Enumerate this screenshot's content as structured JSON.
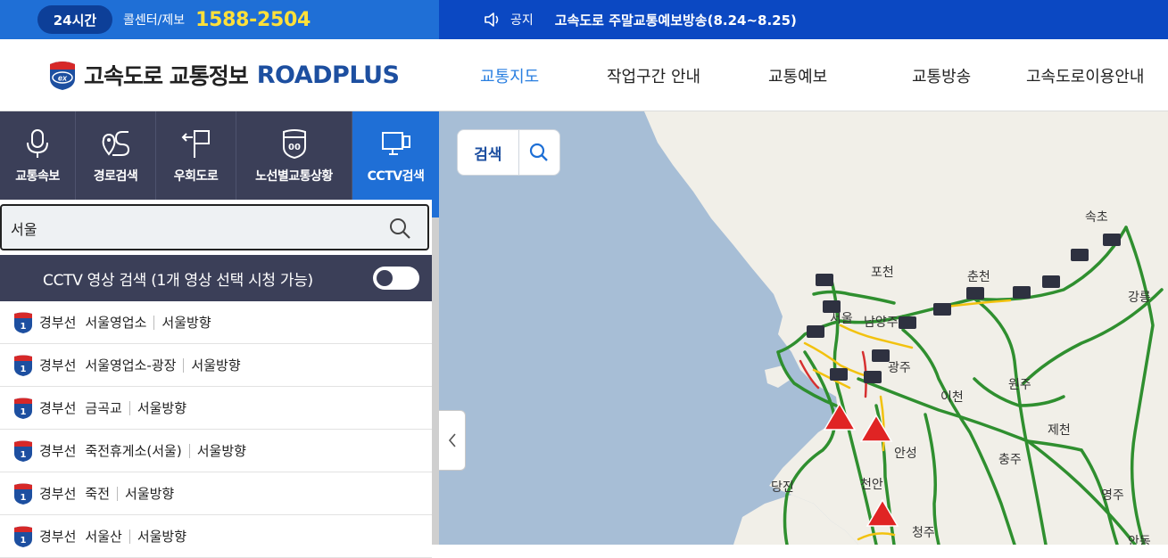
{
  "topbar": {
    "badge": "24시간",
    "callcenter_label": "콜센터/제보",
    "phone": "1588-2504",
    "notice_label": "공지",
    "notice_text": "고속도로 주말교통예보방송(8.24~8.25)"
  },
  "header": {
    "logo_text": "고속도로 교통정보",
    "logo_brand": "ROADPLUS",
    "logo_badge_text": "ex",
    "nav": [
      "교통지도",
      "작업구간 안내",
      "교통예보",
      "교통방송",
      "고속도로이용안내"
    ]
  },
  "tabs": [
    {
      "label": "교통속보",
      "icon": "microphone-icon"
    },
    {
      "label": "경로검색",
      "icon": "route-icon"
    },
    {
      "label": "우회도로",
      "icon": "detour-icon"
    },
    {
      "label": "노선별교통상황",
      "icon": "highway-shield-icon"
    },
    {
      "label": "CCTV검색",
      "icon": "monitor-icon"
    }
  ],
  "search": {
    "value": "서울"
  },
  "cctv_bar": {
    "label": "CCTV 영상 검색 (1개 영상 선택 시청 가능)"
  },
  "list": [
    {
      "route": "경부선",
      "place": "서울영업소",
      "direction": "서울방향",
      "shield_no": "1"
    },
    {
      "route": "경부선",
      "place": "서울영업소-광장",
      "direction": "서울방향",
      "shield_no": "1"
    },
    {
      "route": "경부선",
      "place": "금곡교",
      "direction": "서울방향",
      "shield_no": "1"
    },
    {
      "route": "경부선",
      "place": "죽전휴게소(서울)",
      "direction": "서울방향",
      "shield_no": "1"
    },
    {
      "route": "경부선",
      "place": "죽전",
      "direction": "서울방향",
      "shield_no": "1"
    },
    {
      "route": "경부선",
      "place": "서울산",
      "direction": "서울방향",
      "shield_no": "1"
    }
  ],
  "map": {
    "search_label": "검색",
    "cities": [
      "속초",
      "포천",
      "춘천",
      "강릉",
      "서울",
      "남양주",
      "광주",
      "원주",
      "이천",
      "제천",
      "안성",
      "충주",
      "당진",
      "천안",
      "영주",
      "청주",
      "안동"
    ]
  },
  "colors": {
    "primary": "#1f6fd6",
    "dark": "#0b48c2",
    "panel": "#3b3f58",
    "phone": "#ffe03a"
  }
}
